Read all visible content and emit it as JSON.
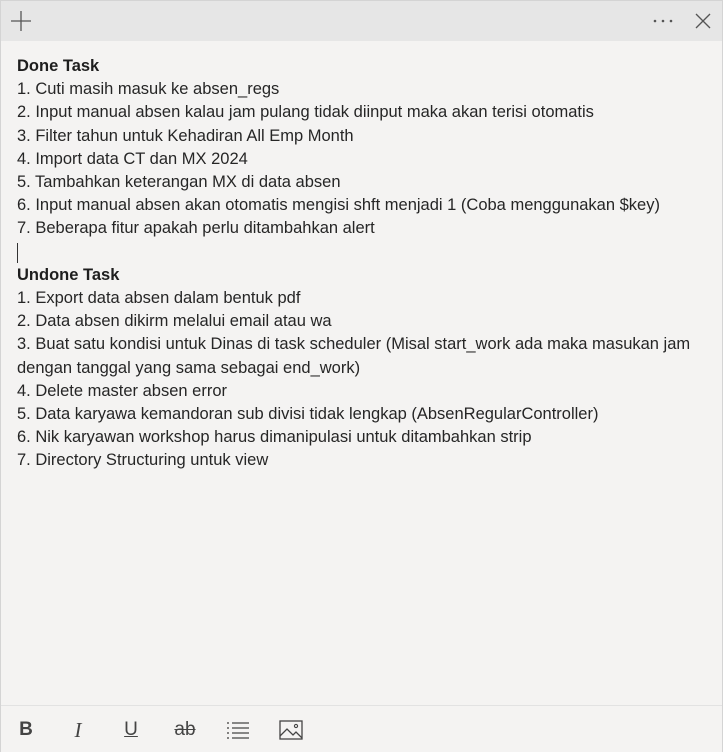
{
  "titlebar": {
    "icons": [
      "plus-icon",
      "more-icon",
      "close-icon"
    ]
  },
  "note": {
    "done_heading": "Done Task",
    "done_items": [
      "1. Cuti masih masuk ke absen_regs",
      "2. Input manual absen kalau jam pulang tidak diinput maka akan terisi otomatis",
      "3. Filter tahun untuk Kehadiran All Emp Month",
      "4. Import data CT dan MX 2024",
      "5. Tambahkan keterangan MX di data absen",
      "6. Input manual absen akan otomatis mengisi shft menjadi 1 (Coba menggunakan $key)",
      "7. Beberapa fitur apakah perlu ditambahkan alert"
    ],
    "undone_heading": "Undone Task",
    "undone_items": [
      "1. Export data absen dalam bentuk pdf",
      "2. Data absen dikirm melalui email atau wa",
      "3. Buat satu kondisi untuk Dinas di task scheduler (Misal start_work ada maka masukan jam dengan tanggal yang sama sebagai end_work)",
      "4. Delete master absen error",
      "5. Data karyawa kemandoran sub divisi tidak lengkap (AbsenRegularController)",
      "6. Nik karyawan workshop harus dimanipulasi untuk ditambahkan strip",
      "7. Directory Structuring untuk view"
    ]
  },
  "toolbar": {
    "bold_label": "B",
    "italic_label": "I",
    "underline_label": "U",
    "strike_label": "ab"
  },
  "colors": {
    "titlebar": "#e6e6e6",
    "background": "#f4f3f2",
    "text": "#262626"
  }
}
